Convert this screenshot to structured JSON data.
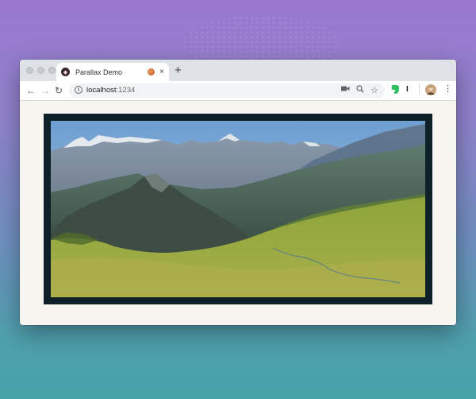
{
  "browser": {
    "tab": {
      "title": "Parallax Demo",
      "favicon_icon": "parallax-favicon-icon",
      "audio_icon": "audio-playing-icon",
      "close_label": "×"
    },
    "new_tab_label": "+",
    "nav": {
      "back": "←",
      "forward": "→",
      "reload": "↻"
    },
    "address": {
      "host": "localhost",
      "port": ":1234"
    },
    "toolbar_icons": [
      "camera-icon",
      "zoom-icon",
      "star-icon",
      "evernote-icon",
      "extension-icon",
      "avatar",
      "menu-icon"
    ],
    "menu_label": "⋮",
    "extension_label": "I"
  },
  "page": {
    "hero_image": "alpine mountain landscape",
    "colors": {
      "frame": "#0d1f27",
      "page_bg": "#f7f5f0",
      "sky": "#8fb8e0"
    }
  }
}
